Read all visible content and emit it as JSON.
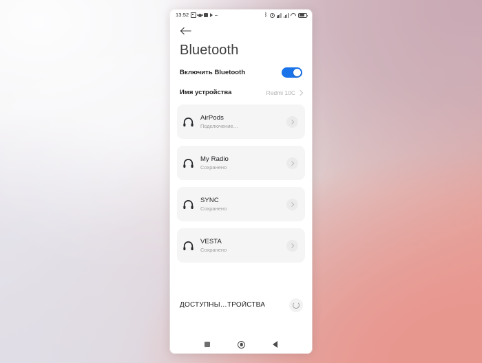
{
  "wallpaper": {
    "colors": {
      "top_left": "#f8f7f9",
      "top_right": "#c9a9b4",
      "bottom_left": "#e0dde6",
      "bottom_right": "#e8978f"
    }
  },
  "status_bar": {
    "time": "13:52",
    "left_icons": [
      "calendar-icon",
      "camera-icon",
      "app-icon",
      "play-icon",
      "dash-icon"
    ],
    "right_icons": [
      "bluetooth-icon",
      "alarm-icon",
      "signal-icon",
      "signal-icon",
      "wifi-icon",
      "battery-icon"
    ],
    "bluetooth_glyph": "ᛒ"
  },
  "header": {
    "back_label": "Back",
    "title": "Bluetooth"
  },
  "toggle_row": {
    "label": "Включить Bluetooth",
    "state": "on",
    "accent": "#1a73e8"
  },
  "device_name_row": {
    "label": "Имя устройства",
    "value": "Redmi 10C"
  },
  "devices": [
    {
      "name": "AirPods",
      "status": "Подключение…",
      "icon": "headphones-icon"
    },
    {
      "name": "My Radio",
      "status": "Сохранено",
      "icon": "headphones-icon"
    },
    {
      "name": "SYNC",
      "status": "Сохранено",
      "icon": "headphones-icon"
    },
    {
      "name": "VESTA",
      "status": "Сохранено",
      "icon": "headphones-icon"
    }
  ],
  "available_section": {
    "label": "ДОСТУПНЫ…ТРОЙСТВА",
    "refresh_icon": "refresh-spinner-icon"
  },
  "nav_bar": {
    "recents_label": "Recents",
    "home_label": "Home",
    "back_label": "Back"
  }
}
